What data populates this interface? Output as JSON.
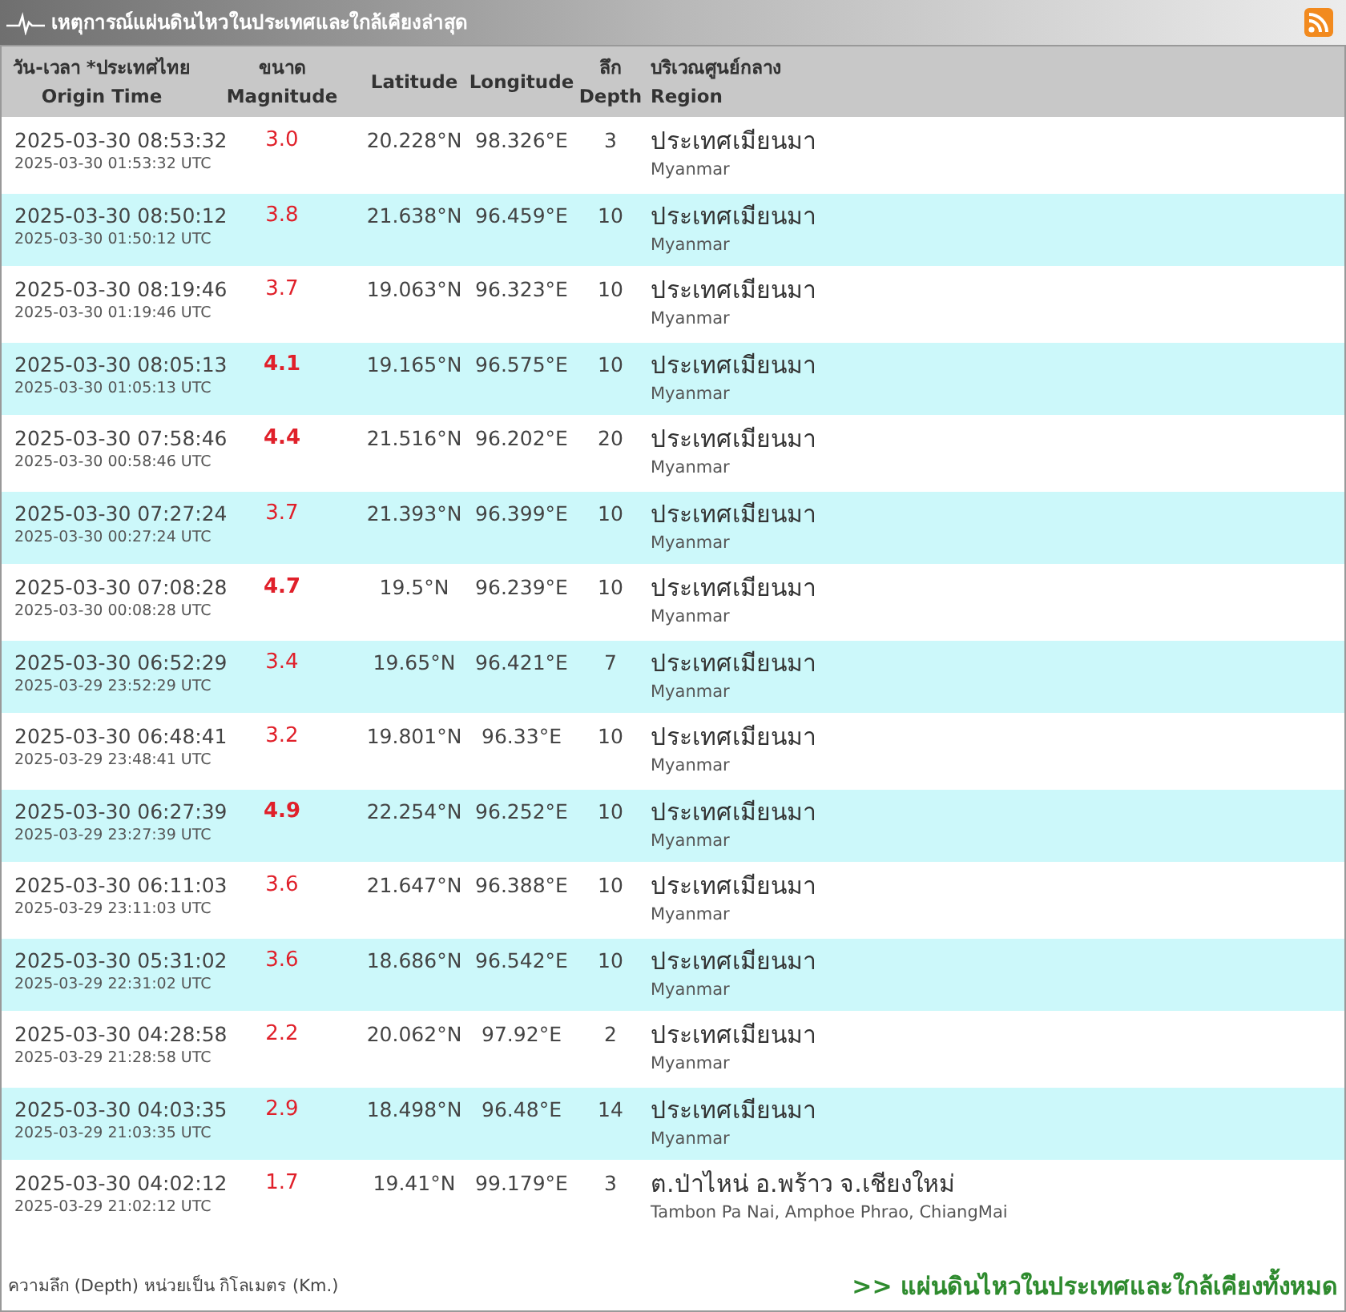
{
  "title": "เหตุการณ์แผ่นดินไหวในประเทศและใกล้เคียงล่าสุด",
  "columns": [
    {
      "th": "วัน-เวลา *ประเทศไทย",
      "en": "Origin Time"
    },
    {
      "th": "ขนาด",
      "en": "Magnitude"
    },
    {
      "en": "Latitude"
    },
    {
      "en": "Longitude"
    },
    {
      "th": "ลึก",
      "en": "Depth"
    },
    {
      "th": "บริเวณศูนย์กลาง",
      "en": "Region"
    }
  ],
  "rows": [
    {
      "time": "2025-03-30 08:53:32",
      "utc": "2025-03-30 01:53:32 UTC",
      "mag": "3.0",
      "strong": false,
      "lat": "20.228°N",
      "lon": "98.326°E",
      "depth": "3",
      "region": "ประเทศเมียนมา",
      "region_en": "Myanmar"
    },
    {
      "time": "2025-03-30 08:50:12",
      "utc": "2025-03-30 01:50:12 UTC",
      "mag": "3.8",
      "strong": false,
      "lat": "21.638°N",
      "lon": "96.459°E",
      "depth": "10",
      "region": "ประเทศเมียนมา",
      "region_en": "Myanmar"
    },
    {
      "time": "2025-03-30 08:19:46",
      "utc": "2025-03-30 01:19:46 UTC",
      "mag": "3.7",
      "strong": false,
      "lat": "19.063°N",
      "lon": "96.323°E",
      "depth": "10",
      "region": "ประเทศเมียนมา",
      "region_en": "Myanmar"
    },
    {
      "time": "2025-03-30 08:05:13",
      "utc": "2025-03-30 01:05:13 UTC",
      "mag": "4.1",
      "strong": true,
      "lat": "19.165°N",
      "lon": "96.575°E",
      "depth": "10",
      "region": "ประเทศเมียนมา",
      "region_en": "Myanmar"
    },
    {
      "time": "2025-03-30 07:58:46",
      "utc": "2025-03-30 00:58:46 UTC",
      "mag": "4.4",
      "strong": true,
      "lat": "21.516°N",
      "lon": "96.202°E",
      "depth": "20",
      "region": "ประเทศเมียนมา",
      "region_en": "Myanmar"
    },
    {
      "time": "2025-03-30 07:27:24",
      "utc": "2025-03-30 00:27:24 UTC",
      "mag": "3.7",
      "strong": false,
      "lat": "21.393°N",
      "lon": "96.399°E",
      "depth": "10",
      "region": "ประเทศเมียนมา",
      "region_en": "Myanmar"
    },
    {
      "time": "2025-03-30 07:08:28",
      "utc": "2025-03-30 00:08:28 UTC",
      "mag": "4.7",
      "strong": true,
      "lat": "19.5°N",
      "lon": "96.239°E",
      "depth": "10",
      "region": "ประเทศเมียนมา",
      "region_en": "Myanmar"
    },
    {
      "time": "2025-03-30 06:52:29",
      "utc": "2025-03-29 23:52:29 UTC",
      "mag": "3.4",
      "strong": false,
      "lat": "19.65°N",
      "lon": "96.421°E",
      "depth": "7",
      "region": "ประเทศเมียนมา",
      "region_en": "Myanmar"
    },
    {
      "time": "2025-03-30 06:48:41",
      "utc": "2025-03-29 23:48:41 UTC",
      "mag": "3.2",
      "strong": false,
      "lat": "19.801°N",
      "lon": "96.33°E",
      "depth": "10",
      "region": "ประเทศเมียนมา",
      "region_en": "Myanmar"
    },
    {
      "time": "2025-03-30 06:27:39",
      "utc": "2025-03-29 23:27:39 UTC",
      "mag": "4.9",
      "strong": true,
      "lat": "22.254°N",
      "lon": "96.252°E",
      "depth": "10",
      "region": "ประเทศเมียนมา",
      "region_en": "Myanmar"
    },
    {
      "time": "2025-03-30 06:11:03",
      "utc": "2025-03-29 23:11:03 UTC",
      "mag": "3.6",
      "strong": false,
      "lat": "21.647°N",
      "lon": "96.388°E",
      "depth": "10",
      "region": "ประเทศเมียนมา",
      "region_en": "Myanmar"
    },
    {
      "time": "2025-03-30 05:31:02",
      "utc": "2025-03-29 22:31:02 UTC",
      "mag": "3.6",
      "strong": false,
      "lat": "18.686°N",
      "lon": "96.542°E",
      "depth": "10",
      "region": "ประเทศเมียนมา",
      "region_en": "Myanmar"
    },
    {
      "time": "2025-03-30 04:28:58",
      "utc": "2025-03-29 21:28:58 UTC",
      "mag": "2.2",
      "strong": false,
      "lat": "20.062°N",
      "lon": "97.92°E",
      "depth": "2",
      "region": "ประเทศเมียนมา",
      "region_en": "Myanmar"
    },
    {
      "time": "2025-03-30 04:03:35",
      "utc": "2025-03-29 21:03:35 UTC",
      "mag": "2.9",
      "strong": false,
      "lat": "18.498°N",
      "lon": "96.48°E",
      "depth": "14",
      "region": "ประเทศเมียนมา",
      "region_en": "Myanmar"
    },
    {
      "time": "2025-03-30 04:02:12",
      "utc": "2025-03-29 21:02:12 UTC",
      "mag": "1.7",
      "strong": false,
      "lat": "19.41°N",
      "lon": "99.179°E",
      "depth": "3",
      "region": "ต.ป่าไหน่ อ.พร้าว จ.เชียงใหม่",
      "region_en": "Tambon Pa Nai, Amphoe Phrao, ChiangMai"
    }
  ],
  "footer_note": "ความลึก (Depth) หน่วยเป็น กิโลเมตร (Km.)",
  "footer_link": ">> แผ่นดินไหวในประเทศและใกล้เคียงทั้งหมด"
}
